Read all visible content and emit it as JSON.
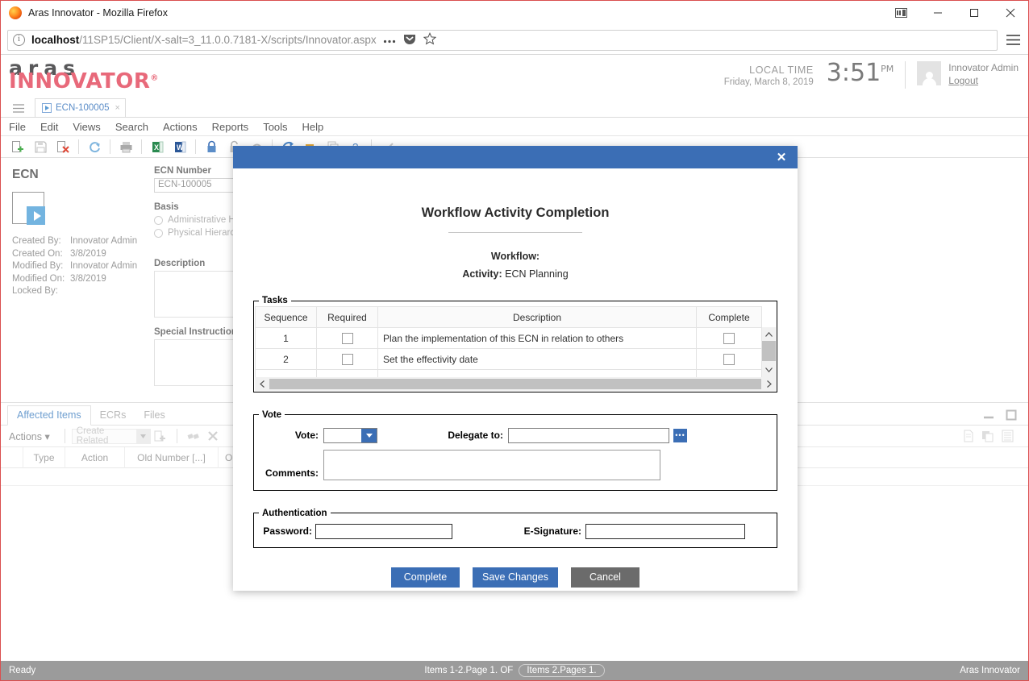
{
  "browser": {
    "title": "Aras Innovator - Mozilla Firefox",
    "url_host": "localhost",
    "url_path": "/11SP15/Client/X-salt=3_11.0.0.7181-X/scripts/Innovator.aspx",
    "minimize_label": "—",
    "maximize_label": "☐",
    "close_label": "✕"
  },
  "app_header": {
    "logo_top": "aras",
    "logo_bottom": "INNOVATOR",
    "logo_mark": "®",
    "local_time_label": "LOCAL TIME",
    "local_date": "Friday, March 8, 2019",
    "clock_time": "3:51",
    "clock_meridiem": "PM",
    "user_name": "Innovator Admin",
    "logout_label": "Logout"
  },
  "tabstrip": {
    "tab_label": "ECN-100005",
    "tab_close": "×"
  },
  "menubar": {
    "items": [
      "File",
      "Edit",
      "Views",
      "Search",
      "Actions",
      "Reports",
      "Tools",
      "Help"
    ]
  },
  "form": {
    "entity_title": "ECN",
    "meta": [
      {
        "label": "Created By:",
        "value": "Innovator Admin"
      },
      {
        "label": "Created On:",
        "value": "3/8/2019"
      },
      {
        "label": "Modified By:",
        "value": "Innovator Admin"
      },
      {
        "label": "Modified On:",
        "value": "3/8/2019"
      },
      {
        "label": "Locked By:",
        "value": ""
      }
    ],
    "ecn_number_label": "ECN Number",
    "ecn_number_value": "ECN-100005",
    "basis_label": "Basis",
    "basis_options": [
      "Administrative Hierarchy",
      "Physical Hierarchy"
    ],
    "description_label": "Description",
    "description_value": "",
    "special_instructions_label": "Special Instructions",
    "special_instructions_value": ""
  },
  "relationship_panel": {
    "tabs": [
      "Affected Items",
      "ECRs",
      "Files"
    ],
    "active_tab": "Affected Items",
    "actions_label": "Actions",
    "actions_caret": "▾",
    "create_related_label": "Create Related",
    "grid_headers": [
      "",
      "Type",
      "Action",
      "Old Number [...]",
      "Old R"
    ]
  },
  "statusbar": {
    "ready": "Ready",
    "items_text": "Items 1-2.Page 1. OF",
    "pages_badge": "Items 2.Pages 1.",
    "brand": "Aras Innovator"
  },
  "modal": {
    "close_label": "✕",
    "heading": "Workflow Activity Completion",
    "workflow_label": "Workflow:",
    "workflow_value": "",
    "activity_label": "Activity:",
    "activity_value": "ECN Planning",
    "tasks": {
      "legend": "Tasks",
      "headers": [
        "Sequence",
        "Required",
        "Description",
        "Complete"
      ],
      "rows": [
        {
          "sequence": "1",
          "required": false,
          "description": "Plan the implementation of this ECN in relation to others",
          "complete": false
        },
        {
          "sequence": "2",
          "required": false,
          "description": "Set the effectivity date",
          "complete": false
        }
      ]
    },
    "vote": {
      "legend": "Vote",
      "vote_label": "Vote:",
      "vote_value": "",
      "delegate_label": "Delegate to:",
      "delegate_value": "",
      "delegate_btn_label": "•••",
      "comments_label": "Comments:",
      "comments_value": ""
    },
    "authentication": {
      "legend": "Authentication",
      "password_label": "Password:",
      "password_value": "",
      "esignature_label": "E-Signature:",
      "esignature_value": ""
    },
    "buttons": {
      "complete": "Complete",
      "save_changes": "Save Changes",
      "cancel": "Cancel"
    }
  },
  "colors": {
    "accent_blue": "#3b6eb5",
    "brand_pink": "#e8697a",
    "brand_gray": "#58585a",
    "neutral_btn": "#6b6b6b",
    "statusbar": "#9b9b9b"
  }
}
